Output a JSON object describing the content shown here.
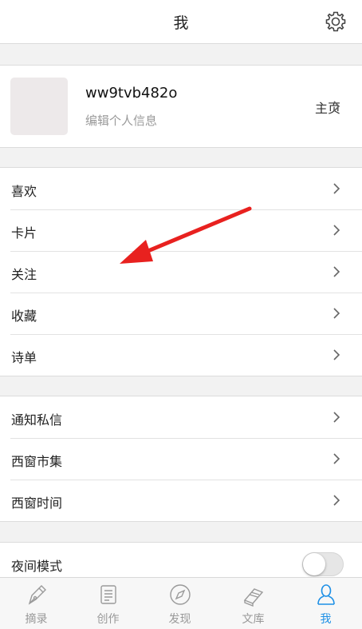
{
  "header": {
    "title": "我",
    "settings_icon": "gear-icon"
  },
  "profile": {
    "username": "ww9tvb482o",
    "edit_label": "编辑个人信息",
    "homepage_label": "主页"
  },
  "menu_group_1": [
    {
      "label": "喜欢"
    },
    {
      "label": "卡片"
    },
    {
      "label": "关注"
    },
    {
      "label": "收藏"
    },
    {
      "label": "诗单"
    }
  ],
  "menu_group_2": [
    {
      "label": "通知私信"
    },
    {
      "label": "西窗市集"
    },
    {
      "label": "西窗时间"
    }
  ],
  "settings": {
    "night_mode_label": "夜间模式",
    "night_mode_on": false
  },
  "tabbar": {
    "tabs": [
      {
        "label": "摘录",
        "icon": "pen-nib-icon"
      },
      {
        "label": "创作",
        "icon": "document-icon"
      },
      {
        "label": "发现",
        "icon": "compass-icon"
      },
      {
        "label": "文库",
        "icon": "books-icon"
      },
      {
        "label": "我",
        "icon": "person-icon",
        "active": true
      }
    ]
  },
  "colors": {
    "accent": "#1e90e6",
    "annotation_arrow": "#e8211f"
  }
}
